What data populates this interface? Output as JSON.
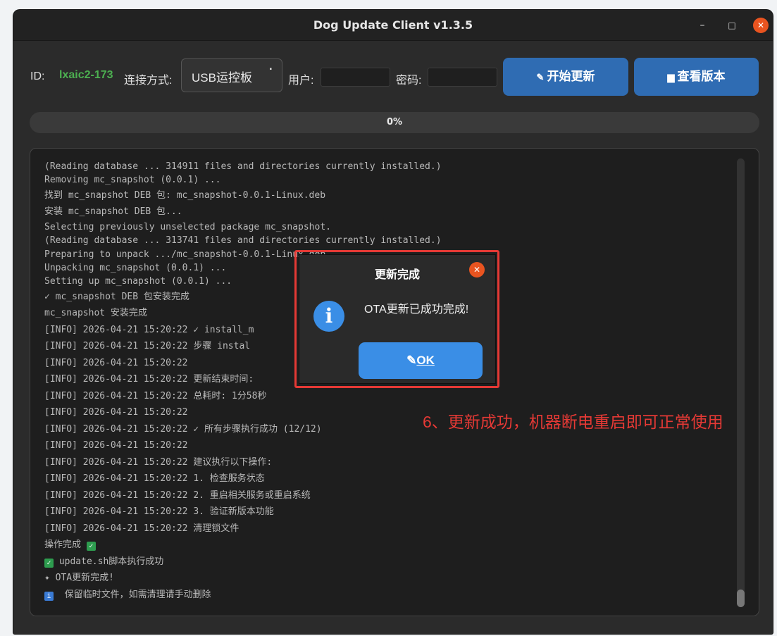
{
  "window": {
    "title": "Dog Update Client v1.3.5",
    "min": "–",
    "max": "□",
    "close": "✕"
  },
  "toolbar": {
    "id_label": "ID:",
    "id_value": "lxaic2-173",
    "conn_label": "连接方式:",
    "conn_value": "USB运控板",
    "conn_arrow": "▪",
    "user_label": "用户:",
    "user_value": "",
    "pass_label": "密码:",
    "pass_value": "",
    "start_icon": "✎",
    "start_label": "开始更新",
    "version_icon": "▆",
    "version_label": "查看版本"
  },
  "progress": {
    "value": 0,
    "label": "0%"
  },
  "log": {
    "lines": [
      "(Reading database ... 314911 files and directories currently installed.)",
      "Removing mc_snapshot (0.0.1) ...",
      "找到 mc_snapshot DEB 包: mc_snapshot-0.0.1-Linux.deb",
      "安装 mc_snapshot DEB 包...",
      "Selecting previously unselected package mc_snapshot.",
      "(Reading database ... 313741 files and directories currently installed.)",
      "Preparing to unpack .../mc_snapshot-0.0.1-Linux.deb ...",
      "Unpacking mc_snapshot (0.0.1) ...",
      "Setting up mc_snapshot (0.0.1) ...",
      "✓ mc_snapshot DEB 包安装完成",
      "mc_snapshot 安装完成",
      "[INFO] 2026-04-21 15:20:22 ✓ install_m",
      "[INFO] 2026-04-21 15:20:22 步骤 instal",
      "[INFO] 2026-04-21 15:20:22",
      "[INFO] 2026-04-21 15:20:22 更新结束时间:",
      "[INFO] 2026-04-21 15:20:22 总耗时: 1分58秒",
      "[INFO] 2026-04-21 15:20:22",
      "[INFO] 2026-04-21 15:20:22 ✓ 所有步骤执行成功 (12/12)",
      "[INFO] 2026-04-21 15:20:22",
      "[INFO] 2026-04-21 15:20:22 建议执行以下操作:",
      "[INFO] 2026-04-21 15:20:22 1. 检查服务状态",
      "[INFO] 2026-04-21 15:20:22 2. 重启相关服务或重启系统",
      "[INFO] 2026-04-21 15:20:22 3. 验证新版本功能",
      "[INFO] 2026-04-21 15:20:22 清理锁文件"
    ],
    "done_line": "操作完成",
    "script_ok": "update.sh脚本执行成功",
    "ota_done": "OTA更新完成!",
    "keep_tmp": "保留临时文件，如需清理请手动删除"
  },
  "dialog": {
    "title": "更新完成",
    "message": "OTA更新已成功完成!",
    "icon": "i",
    "ok_prefix": "✎",
    "ok_label": "OK"
  },
  "annotation": "6、更新成功，机器断电重启即可正常使用",
  "colors": {
    "accent": "#2f6cb3",
    "close": "#e95420",
    "highlight": "#e53935",
    "id_green": "#4caf50"
  }
}
